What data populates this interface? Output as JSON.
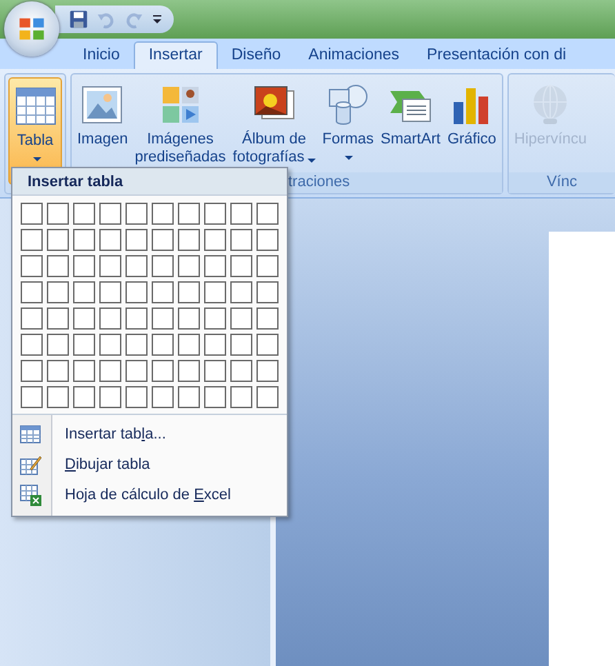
{
  "quick_access": [
    {
      "kind": "save",
      "disabled": false
    },
    {
      "kind": "undo",
      "disabled": true
    },
    {
      "kind": "redo",
      "disabled": true
    },
    {
      "kind": "customize",
      "disabled": false
    }
  ],
  "tabs": [
    {
      "label": "Inicio",
      "selected": false
    },
    {
      "label": "Insertar",
      "selected": true
    },
    {
      "label": "Diseño",
      "selected": false
    },
    {
      "label": "Animaciones",
      "selected": false
    },
    {
      "label": "Presentación con di",
      "selected": false
    }
  ],
  "ribbon": {
    "groups": [
      {
        "buttons": [
          {
            "kind": "table",
            "lines": [
              "Tabla"
            ],
            "dropdown": true,
            "selected": true,
            "disabled": false
          }
        ]
      },
      {
        "label": "traciones",
        "buttons": [
          {
            "kind": "image",
            "lines": [
              "Imagen"
            ],
            "dropdown": false,
            "selected": false,
            "disabled": false
          },
          {
            "kind": "clipart",
            "lines": [
              "Imágenes",
              "prediseñadas"
            ],
            "dropdown": false,
            "selected": false,
            "disabled": false
          },
          {
            "kind": "album",
            "lines": [
              "Álbum de",
              "fotografías"
            ],
            "dropdown": true,
            "selected": false,
            "disabled": false
          },
          {
            "kind": "shapes",
            "lines": [
              "Formas"
            ],
            "dropdown": true,
            "selected": false,
            "disabled": false
          },
          {
            "kind": "smartart",
            "lines": [
              "SmartArt"
            ],
            "dropdown": false,
            "selected": false,
            "disabled": false
          },
          {
            "kind": "chart",
            "lines": [
              "Gráfico"
            ],
            "dropdown": false,
            "selected": false,
            "disabled": false
          }
        ]
      },
      {
        "label": "Vínc",
        "buttons": [
          {
            "kind": "link",
            "lines": [
              "Hipervíncu"
            ],
            "dropdown": false,
            "selected": false,
            "disabled": true
          }
        ]
      }
    ]
  },
  "menu": {
    "title": "Insertar tabla",
    "items": [
      {
        "kind": "insert",
        "before": "Insertar tab",
        "key": "l",
        "after": "a..."
      },
      {
        "kind": "draw",
        "key": "D",
        "after": "ibujar tabla"
      },
      {
        "kind": "excel",
        "before": "Hoja de cálculo de ",
        "key": "E",
        "after": "xcel"
      }
    ]
  }
}
